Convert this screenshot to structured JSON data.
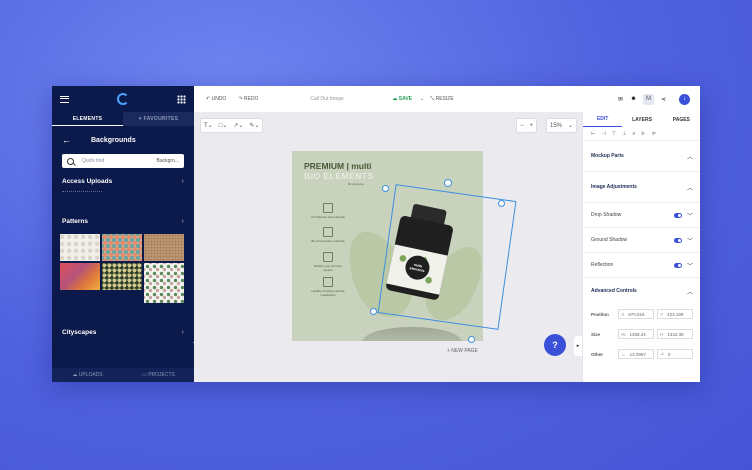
{
  "sidebar": {
    "tabs": [
      "ELEMENTS",
      "♥ FAVOURITES"
    ],
    "header": "Backgrounds",
    "search": {
      "placeholder": "Quick find",
      "category": "Backgro..."
    },
    "sections": [
      "Access Uploads",
      "Patterns",
      "Cityscapes"
    ],
    "bottom": [
      "UPLOADS",
      "PROJECTS"
    ],
    "pattern_colors": [
      "#ece9e2",
      "#d9a98d",
      "#b98f6c",
      "#d96a5b",
      "#6a7c4f",
      "#f1f1ee"
    ]
  },
  "topbar": {
    "undo": "UNDO",
    "redo": "REDO",
    "doc_name": "Call Out Image",
    "save": "SAVE",
    "resize": "RESIZE",
    "avatar_letter": "M"
  },
  "canvas": {
    "zoom": "15%",
    "doc_title": "PREMIUM | multi",
    "doc_subtitle": "BIO ELEMENTS",
    "doc_subtitle2": "60 capsules",
    "features": [
      "22 Vitamins and minerals",
      "Bio & bio-active nutrients",
      "Bolster your immune system",
      "Healthy functions and fat metabolism"
    ],
    "bottle_brand": "multi elements",
    "new_page": "+ NEW PAGE",
    "help": "?"
  },
  "right_panel": {
    "tabs": [
      "EDIT",
      "LAYERS",
      "PAGES"
    ],
    "align_icons": [
      "⊢",
      "⊣",
      "⊤",
      "⊥",
      "≡",
      "⊪",
      "⊫"
    ],
    "sections": [
      {
        "title": "Mockup Parts",
        "chevron": "up"
      },
      {
        "title": "Image Adjustments",
        "chevron": "up"
      }
    ],
    "toggles": [
      "Drop Shadow",
      "Ground Shadow",
      "Reflection"
    ],
    "advanced": "Advanced Controls",
    "position": {
      "label": "Position",
      "x": "970.516",
      "y": "423.199"
    },
    "size": {
      "label": "Size",
      "w": "1258.44",
      "h": "1342.36"
    },
    "other": {
      "label": "Other",
      "a": "13.2967",
      "b": "0"
    }
  }
}
